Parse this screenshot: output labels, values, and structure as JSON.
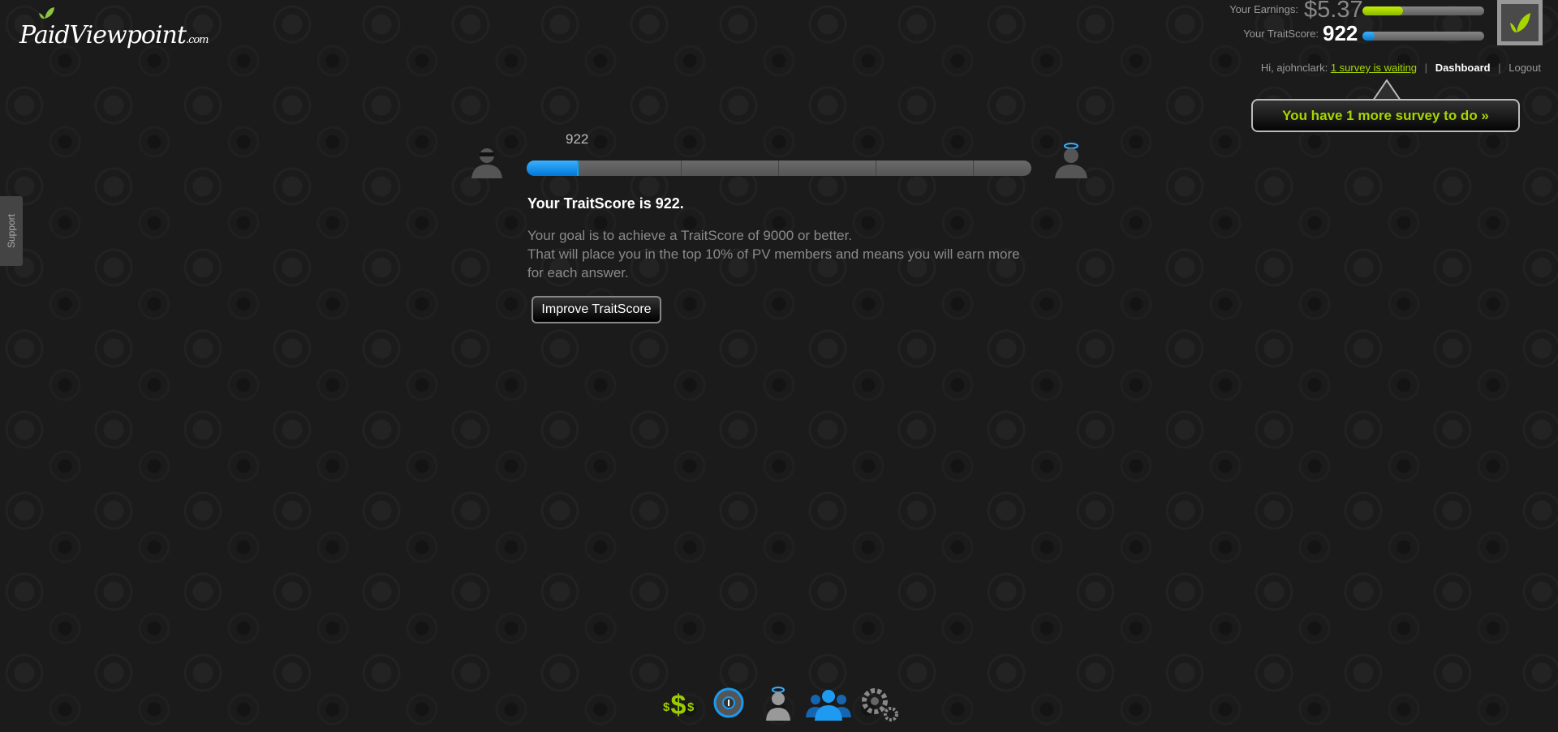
{
  "logo": {
    "text": "PaidViewpoint",
    "suffix": ".com"
  },
  "header": {
    "earnings_label": "Your Earnings:",
    "earnings_value": "$5.37",
    "earnings_progress": 0.33,
    "traitscore_label": "Your TraitScore:",
    "traitscore_value": "922",
    "traitscore_progress": 0.1,
    "greeting": "Hi, ajohnclark:",
    "survey_link": "1 survey is waiting",
    "dashboard": "Dashboard",
    "logout": "Logout",
    "separator": "|",
    "callout": "You have 1 more survey to do »"
  },
  "support": "Support",
  "main": {
    "slider_label": "922",
    "slider_value": 922,
    "slider_max": 9000,
    "heading": "Your TraitScore is 922.",
    "desc_line1": "Your goal is to achieve a TraitScore of 9000 or better.",
    "desc_line2": "That will place you in the top 10% of PV members and means you will earn more for each answer.",
    "button": "Improve TraitScore"
  },
  "bottom_nav": [
    "dollar-icon",
    "info-dial-icon",
    "angel-user-icon",
    "members-icon",
    "gears-icon"
  ],
  "colors": {
    "accent_green": "#a6d600",
    "accent_blue": "#1a9bf0"
  }
}
